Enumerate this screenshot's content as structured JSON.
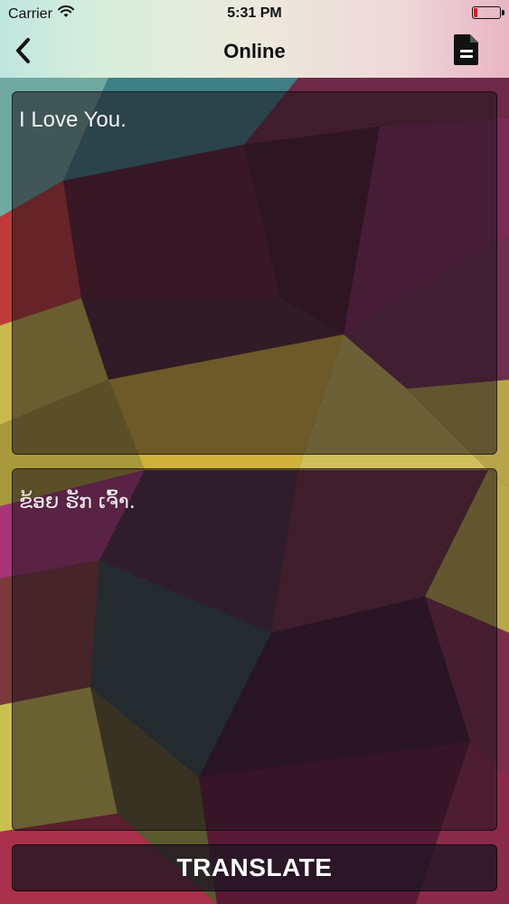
{
  "status_bar": {
    "carrier": "Carrier",
    "time": "5:31 PM",
    "wifi_icon": "wifi-icon",
    "battery_icon": "battery-icon",
    "battery_color": "#e0191c"
  },
  "nav": {
    "title": "Online",
    "back_icon": "chevron-left-icon",
    "document_icon": "document-icon"
  },
  "source": {
    "text": "I Love You."
  },
  "target": {
    "text": "ຂ້ອຍ ຮັກ ເຈົ້າ."
  },
  "actions": {
    "translate_label": "TRANSLATE"
  },
  "colors": {
    "text": "#f2f2f2",
    "panel_bg": "#1c121a"
  }
}
